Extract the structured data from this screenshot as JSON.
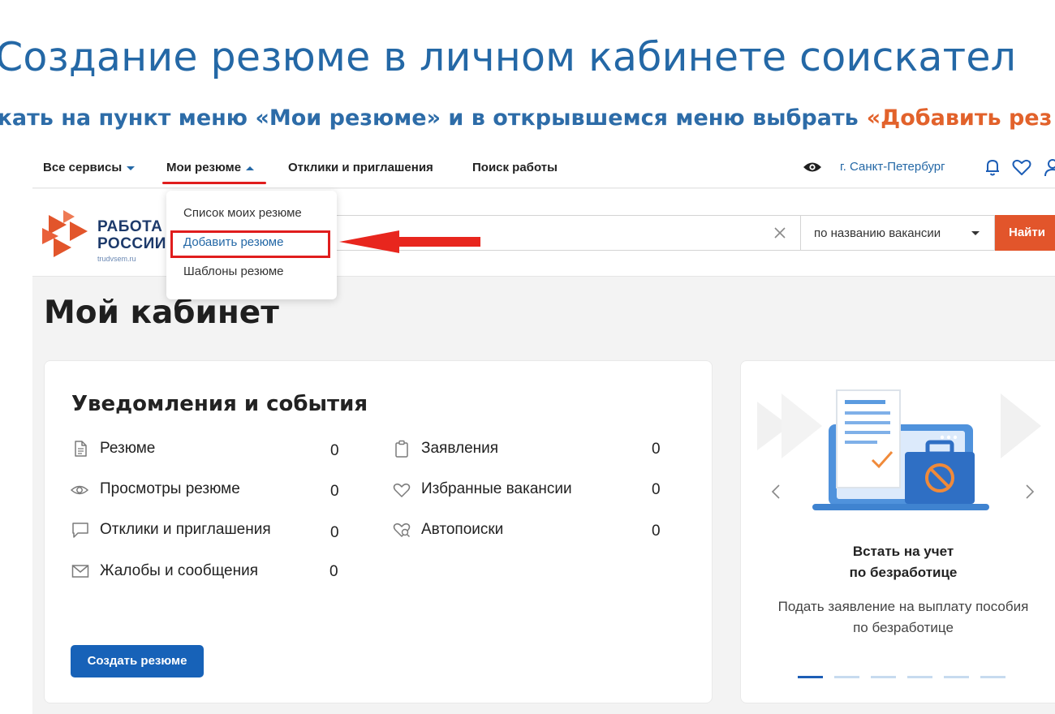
{
  "slide": {
    "title": "Создание резюме в личном кабинете соискател",
    "instruction": "жать на пункт меню «Мои резюме» и в открывшемся меню выбрать",
    "instruction_accent": "«Добавить рез"
  },
  "topnav": {
    "items": [
      {
        "label": "Все сервисы"
      },
      {
        "label": "Мои резюме"
      },
      {
        "label": "Отклики и приглашения"
      },
      {
        "label": "Поиск работы"
      }
    ],
    "city": "г. Санкт-Петербург"
  },
  "logo": {
    "line1": "РАБОТА",
    "line2": "РОССИИ",
    "sub": "trudvsem.ru"
  },
  "search": {
    "select_value": "по названию вакансии",
    "button_label": "Найти"
  },
  "dropdown": {
    "items": [
      {
        "label": "Список моих резюме"
      },
      {
        "label": "Добавить резюме"
      },
      {
        "label": "Шаблоны резюме"
      }
    ]
  },
  "cabinet": {
    "title": "Мой кабинет"
  },
  "notifications": {
    "title": "Уведомления и события",
    "left": [
      {
        "label": "Резюме",
        "count": "0",
        "icon": "document-icon"
      },
      {
        "label": "Просмотры резюме",
        "count": "0",
        "icon": "eye-icon"
      },
      {
        "label": "Отклики и приглашения",
        "count": "0",
        "icon": "chat-icon"
      },
      {
        "label": "Жалобы и сообщения",
        "count": "0",
        "icon": "mail-icon"
      }
    ],
    "right": [
      {
        "label": "Заявления",
        "count": "0",
        "icon": "clipboard-icon"
      },
      {
        "label": "Избранные вакансии",
        "count": "0",
        "icon": "heart-icon"
      },
      {
        "label": "Автопоиски",
        "count": "0",
        "icon": "autosearch-icon"
      }
    ],
    "create_button": "Создать резюме"
  },
  "promo": {
    "title_line1": "Встать на учет",
    "title_line2": "по безработице",
    "text_line1": "Подать заявление на выплату пособия",
    "text_line2": "по безработице",
    "slides_total": 6,
    "active_slide": 1
  },
  "colors": {
    "brand_blue": "#2468a6",
    "accent_orange": "#e2552b",
    "highlight_red": "#e01d1d",
    "button_blue": "#1762b8"
  }
}
